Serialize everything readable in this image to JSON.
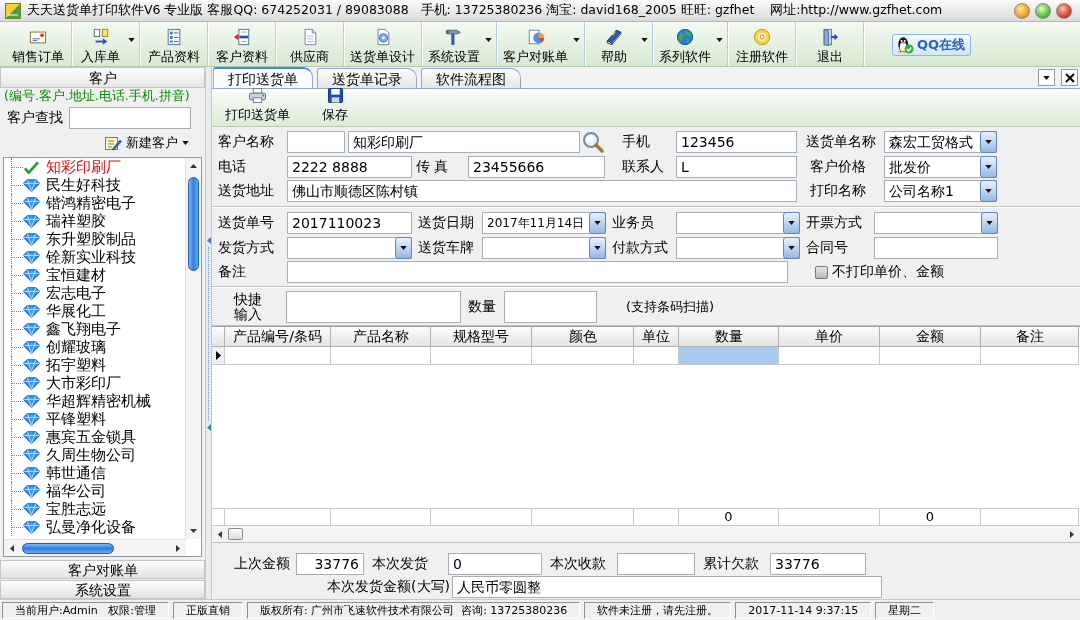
{
  "window": {
    "title": "天天送货单打印软件V6 专业版 客服QQ: 674252031 / 89083088   手机: 13725380236 淘宝: david168_2005 旺旺: gzfhet    网址:http://www.gzfhet.com"
  },
  "toolbar": {
    "buttons": [
      {
        "label": "销售订单",
        "menu": false
      },
      {
        "label": "入库单",
        "menu": true
      },
      {
        "label": "产品资料",
        "menu": false
      },
      {
        "label": "客户资料",
        "menu": false
      },
      {
        "label": "供应商",
        "menu": false
      },
      {
        "label": "送货单设计",
        "menu": false
      },
      {
        "label": "系统设置",
        "menu": true
      },
      {
        "label": "客户对账单",
        "menu": true
      },
      {
        "label": "帮助",
        "menu": true
      },
      {
        "label": "系列软件",
        "menu": true
      },
      {
        "label": "注册软件",
        "menu": false
      },
      {
        "label": "退出",
        "menu": false
      }
    ],
    "qq_button": {
      "label": "QQ在线"
    }
  },
  "sidebar": {
    "title": "客户",
    "hint": "(编号.客户.地址.电话.手机.拼音)",
    "search": {
      "label": "客户查找"
    },
    "new_button": {
      "label": "新建客户",
      "menu": true
    },
    "customers": [
      {
        "label": "知彩印刷厂",
        "selected": true
      },
      {
        "label": "民生好科技",
        "selected": false
      },
      {
        "label": "锴鸿精密电子",
        "selected": false
      },
      {
        "label": "瑞祥塑胶",
        "selected": false
      },
      {
        "label": "东升塑胶制品",
        "selected": false
      },
      {
        "label": "铨新实业科技",
        "selected": false
      },
      {
        "label": "宝恒建材",
        "selected": false
      },
      {
        "label": "宏志电子",
        "selected": false
      },
      {
        "label": "华展化工",
        "selected": false
      },
      {
        "label": "鑫飞翔电子",
        "selected": false
      },
      {
        "label": "创耀玻璃",
        "selected": false
      },
      {
        "label": "拓宇塑料",
        "selected": false
      },
      {
        "label": "大市彩印厂",
        "selected": false
      },
      {
        "label": "华超辉精密机械",
        "selected": false
      },
      {
        "label": "平锋塑料",
        "selected": false
      },
      {
        "label": "惠宾五金锁具",
        "selected": false
      },
      {
        "label": "久周生物公司",
        "selected": false
      },
      {
        "label": "韩世通信",
        "selected": false
      },
      {
        "label": "福华公司",
        "selected": false
      },
      {
        "label": "宝胜志远",
        "selected": false
      },
      {
        "label": "弘曼净化设备",
        "selected": false
      }
    ],
    "bottom_buttons": [
      {
        "label": "客户对账单"
      },
      {
        "label": "系统设置"
      }
    ]
  },
  "tabs": [
    {
      "label": "打印送货单",
      "selected": true
    },
    {
      "label": "送货单记录",
      "selected": false
    },
    {
      "label": "软件流程图",
      "selected": false
    }
  ],
  "actions": [
    {
      "label": "打印送货单"
    },
    {
      "label": "保存"
    }
  ],
  "form": {
    "customer_name": {
      "label": "客户名称",
      "value": "知彩印刷厂"
    },
    "mobile": {
      "label": "手机",
      "value": "123456"
    },
    "slip_name": {
      "label": "送货单名称",
      "value": "森宏工贸格式"
    },
    "phone": {
      "label": "电话",
      "value": "2222 8888"
    },
    "fax": {
      "label": "传 真",
      "value": "23455666"
    },
    "contact": {
      "label": "联系人",
      "value": "L"
    },
    "price_type": {
      "label": "客户价格",
      "value": "批发价"
    },
    "address": {
      "label": "送货地址",
      "value": "佛山市顺德区陈村镇"
    },
    "print_name": {
      "label": "打印名称",
      "value": "公司名称1"
    },
    "slip_no": {
      "label": "送货单号",
      "value": "2017110023"
    },
    "date": {
      "label": "送货日期",
      "value": "2017年11月14日"
    },
    "salesperson": {
      "label": "业务员"
    },
    "invoice": {
      "label": "开票方式"
    },
    "shipping": {
      "label": "发货方式"
    },
    "plate": {
      "label": "送货车牌"
    },
    "payment": {
      "label": "付款方式"
    },
    "contract": {
      "label": "合同号"
    },
    "remark": {
      "label": "备注"
    },
    "hide_prices": {
      "label": "不打印单价、金额",
      "checked": false
    }
  },
  "quick_entry": {
    "input": {
      "label": "快捷输入"
    },
    "quantity": {
      "label": "数量"
    },
    "note": "(支持条码扫描)"
  },
  "table": {
    "columns": [
      {
        "label": "产品编号/条码"
      },
      {
        "label": "产品名称"
      },
      {
        "label": "规格型号"
      },
      {
        "label": "颜色"
      },
      {
        "label": "单位"
      },
      {
        "label": "数量",
        "total": "0"
      },
      {
        "label": "单价"
      },
      {
        "label": "金额",
        "total": "0"
      },
      {
        "label": "备注"
      }
    ],
    "rows": [
      {
        "selected": true,
        "cells": [
          {
            "selected": false
          },
          {
            "selected": false
          },
          {
            "selected": false
          },
          {
            "selected": false
          },
          {
            "selected": false
          },
          {
            "selected": true
          },
          {
            "selected": false
          },
          {
            "selected": false
          },
          {
            "selected": false
          }
        ]
      }
    ]
  },
  "summary": {
    "fields": [
      {
        "label": "上次金额",
        "value": "33776"
      },
      {
        "label": "本次发货",
        "value": "0"
      },
      {
        "label": "本次收款"
      },
      {
        "label": "累计欠款",
        "value": "33776"
      }
    ],
    "amount_in_words": {
      "label": "本次发货金额(大写)",
      "value": "人民币零圆整"
    }
  },
  "status_bar": [
    "当前用户:Admin   权限:管理",
    "正版直销",
    "版权所有: 广州市飞速软件技术有限公司  咨询: 13725380236",
    "软件未注册，请先注册。",
    "2017-11-14 9:37:15",
    "星期二"
  ]
}
